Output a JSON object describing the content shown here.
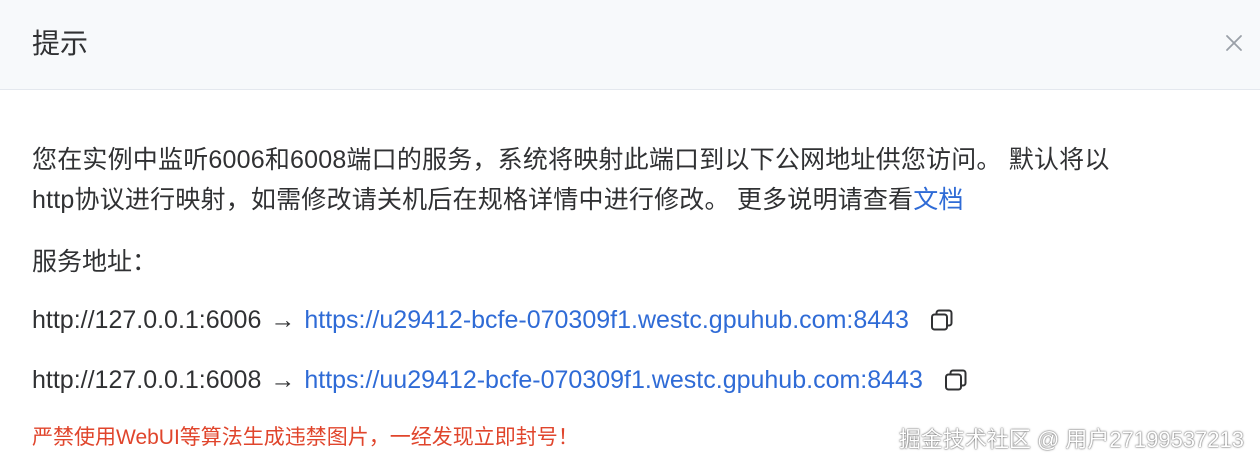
{
  "dialog": {
    "title": "提示",
    "close_icon": "close-icon"
  },
  "notice": {
    "line1": "您在实例中监听6006和6008端口的服务，系统将映射此端口到以下公网地址供您访问。 默认将以",
    "line2_prefix": "http协议进行映射，如需修改请关机后在规格详情中进行修改。 更多说明请查看",
    "doc_link": "文档"
  },
  "service": {
    "label": "服务地址：",
    "mappings": [
      {
        "local": "http://127.0.0.1:6006",
        "arrow": "→",
        "public": "https://u29412-bcfe-070309f1.westc.gpuhub.com:8443",
        "copy_icon": "copy-icon"
      },
      {
        "local": "http://127.0.0.1:6008",
        "arrow": "→",
        "public": "https://uu29412-bcfe-070309f1.westc.gpuhub.com:8443",
        "copy_icon": "copy-icon"
      }
    ]
  },
  "warning": "严禁使用WebUI等算法生成违禁图片，一经发现立即封号！",
  "watermark": "掘金技术社区 @ 用户27199537213",
  "colors": {
    "link": "#2f6bd6",
    "warning": "#e0452c",
    "text": "#303133",
    "header_bg": "#f7f9fb"
  }
}
